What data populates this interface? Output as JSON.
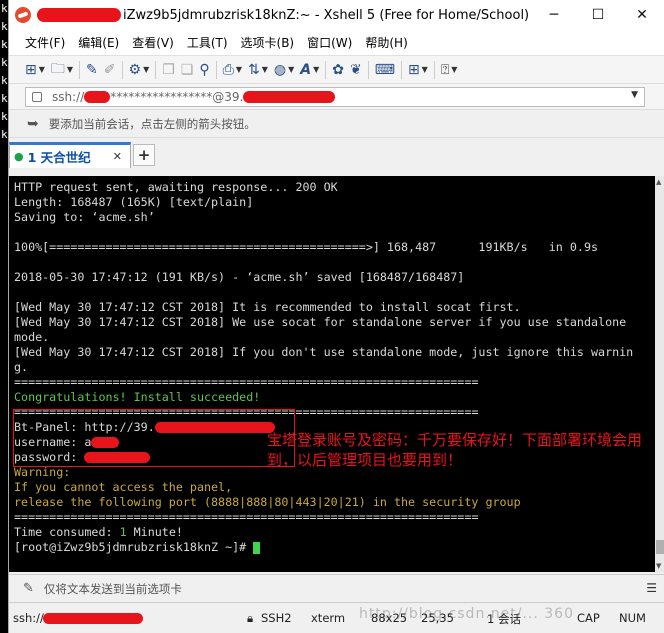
{
  "left_strip": [
    "k",
    "k",
    "k",
    "k",
    "k",
    "k",
    "k",
    "k"
  ],
  "window": {
    "title_suffix": "iZwz9b5jdmrubzrisk18knZ:~ - Xshell 5 (Free for Home/School)",
    "min_glyph": "─",
    "max_glyph": "☐",
    "close_glyph": "✕"
  },
  "menu": [
    "文件(F)",
    "编辑(E)",
    "查看(V)",
    "工具(T)",
    "选项卡(B)",
    "窗口(W)",
    "帮助(H)"
  ],
  "address": {
    "prefix": "ssh://",
    "middle": "*****************@39."
  },
  "hint": "要添加当前会话，点击左侧的箭头按钮。",
  "tab": {
    "dot": "●",
    "label": "1 天合世纪",
    "close": "✕",
    "add": "+"
  },
  "terminal": {
    "l1": "HTTP request sent, awaiting response... 200 OK",
    "l2": "Length: 168487 (165K) [text/plain]",
    "l3": "Saving to: ‘acme.sh’",
    "l4": "",
    "l5": "100%[=============================================>] 168,487      191KB/s   in 0.9s",
    "l6": "",
    "l7": "2018-05-30 17:47:12 (191 KB/s) - ‘acme.sh’ saved [168487/168487]",
    "l8": "",
    "l9": "[Wed May 30 17:47:12 CST 2018] It is recommended to install socat first.",
    "l10": "[Wed May 30 17:47:12 CST 2018] We use socat for standalone server if you use standalone",
    "l11": "mode.",
    "l12": "[Wed May 30 17:47:12 CST 2018] If you don't use standalone mode, just ignore this warnin",
    "l13": "g.",
    "l14": "==================================================================",
    "l15": "Congratulations! Install succeeded!",
    "l16": "==================================================================",
    "l17": "Bt-Panel: http://39.",
    "l18": "username: a",
    "l19": "password: ",
    "l20": "Warning:",
    "l21": "If you cannot access the panel,",
    "l22": "release the following port (8888|888|80|443|20|21) in the security group",
    "l23": "==================================================================",
    "l24_a": "Time consumed: ",
    "l24_b": "1",
    "l24_c": " Minute!",
    "prompt": "[root@iZwz9b5jdmrubzrisk18knZ ~]# "
  },
  "annotation": "宝塔登录账号及密码：千万要保存好！下面部署环境会用到，以后管理项目也要用到！",
  "sendbar": {
    "text": "仅将文本发送到当前选项卡",
    "menu": "☰"
  },
  "status": {
    "ssh": "ssh://",
    "proto": "SSH2",
    "term": "xterm",
    "size": "88x25",
    "pos": "25,35",
    "sessions": "1 会话",
    "watermark": "http://blog.csdn.net/... 360",
    "caps": "CAP",
    "num": "NUM"
  },
  "colors": {
    "accent": "#2f7bd3",
    "redaction": "#e8141b",
    "terminal_bg": "#000000",
    "terminal_green": "#5fc44d",
    "terminal_yellow": "#c9a93a"
  }
}
